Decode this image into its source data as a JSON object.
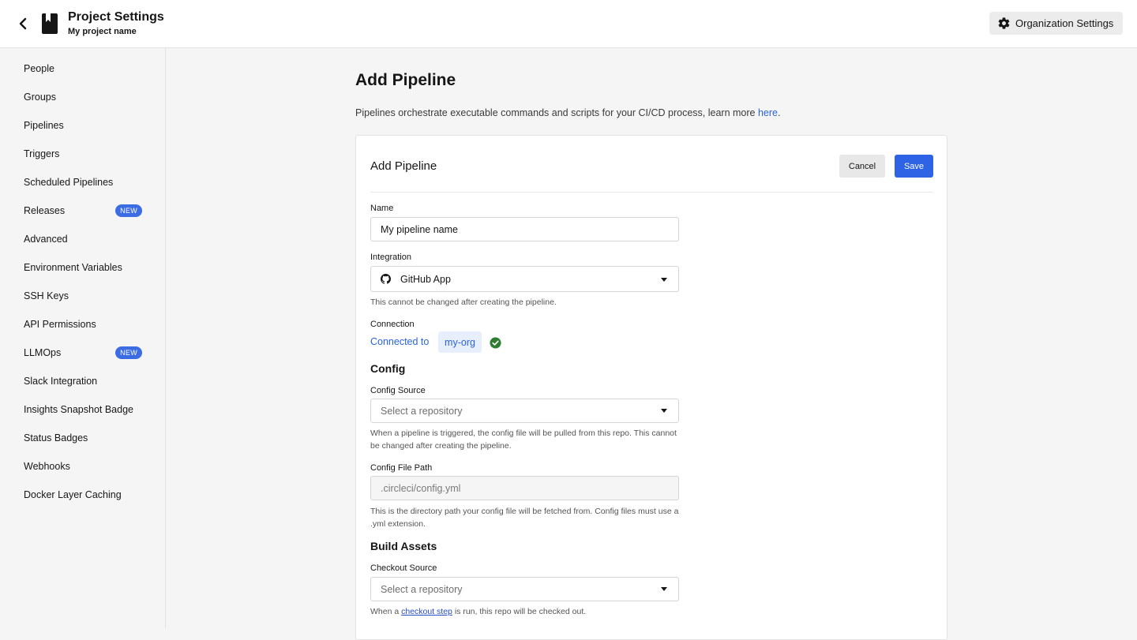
{
  "header": {
    "title": "Project Settings",
    "subtitle": "My project name",
    "org_settings_label": "Organization Settings"
  },
  "sidebar": {
    "items": [
      {
        "label": "People"
      },
      {
        "label": "Groups"
      },
      {
        "label": "Pipelines"
      },
      {
        "label": "Triggers"
      },
      {
        "label": "Scheduled Pipelines"
      },
      {
        "label": "Releases",
        "badge": "NEW"
      },
      {
        "label": "Advanced"
      },
      {
        "label": "Environment Variables"
      },
      {
        "label": "SSH Keys"
      },
      {
        "label": "API Permissions"
      },
      {
        "label": "LLMOps",
        "badge": "NEW"
      },
      {
        "label": "Slack Integration"
      },
      {
        "label": "Insights Snapshot Badge"
      },
      {
        "label": "Status Badges"
      },
      {
        "label": "Webhooks"
      },
      {
        "label": "Docker Layer Caching"
      }
    ]
  },
  "page": {
    "title": "Add Pipeline",
    "description": "Pipelines orchestrate executable commands and scripts for your CI/CD process, learn more ",
    "description_link": "here",
    "description_end": "."
  },
  "form": {
    "title": "Add Pipeline",
    "cancel_label": "Cancel",
    "save_label": "Save",
    "name_label": "Name",
    "name_value": "My pipeline name",
    "integration_label": "Integration",
    "integration_value": "GitHub App",
    "integration_help": "This cannot be changed after creating the pipeline.",
    "connection_label": "Connection",
    "connection_text": "Connected to",
    "connection_org": "my-org",
    "config_heading": "Config",
    "config_source_label": "Config Source",
    "config_source_placeholder": "Select a repository",
    "config_source_help": "When a pipeline is triggered, the config file will be pulled from this repo. This cannot be changed after creating the pipeline.",
    "config_path_label": "Config File Path",
    "config_path_value": ".circleci/config.yml",
    "config_path_help": "This is the directory path your config file will be fetched from. Config files must use a .yml extension.",
    "build_heading": "Build Assets",
    "checkout_label": "Checkout Source",
    "checkout_placeholder": "Select a repository",
    "checkout_help_pre": "When a ",
    "checkout_help_link": "checkout step",
    "checkout_help_post": " is run, this repo will be checked out."
  },
  "colors": {
    "accent": "#2e63e6",
    "badge": "#3b6ce4",
    "success": "#2e7d32"
  }
}
